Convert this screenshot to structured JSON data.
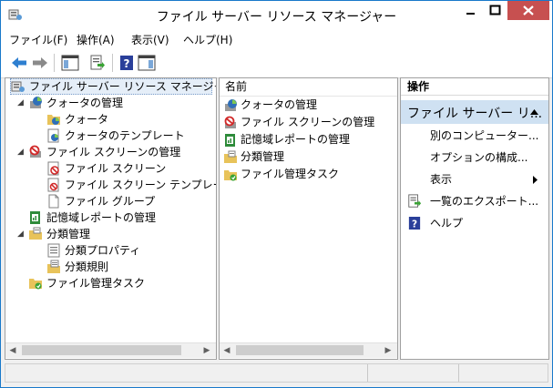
{
  "window": {
    "title": "ファイル サーバー リソース マネージャー",
    "accent_color": "#1979ca",
    "close_color": "#c75050"
  },
  "menu": {
    "items": [
      {
        "label": "ファイル(F)"
      },
      {
        "label": "操作(A)"
      },
      {
        "label": "表示(V)"
      },
      {
        "label": "ヘルプ(H)"
      }
    ]
  },
  "toolbar": {
    "icons": [
      "back-arrow-icon",
      "forward-arrow-icon",
      "show-hide-console-tree-icon",
      "export-list-icon",
      "help-icon",
      "show-hide-action-pane-icon"
    ]
  },
  "tree": {
    "root": "ファイル サーバー リソース マネージャー (ロ-",
    "items": [
      {
        "label": "クォータの管理"
      },
      {
        "label": "クォータ"
      },
      {
        "label": "クォータのテンプレート"
      },
      {
        "label": "ファイル スクリーンの管理"
      },
      {
        "label": "ファイル スクリーン"
      },
      {
        "label": "ファイル スクリーン テンプレート"
      },
      {
        "label": "ファイル グループ"
      },
      {
        "label": "記憶域レポートの管理"
      },
      {
        "label": "分類管理"
      },
      {
        "label": "分類プロパティ"
      },
      {
        "label": "分類規則"
      },
      {
        "label": "ファイル管理タスク"
      }
    ]
  },
  "list": {
    "column_header": "名前",
    "items": [
      {
        "label": "クォータの管理"
      },
      {
        "label": "ファイル スクリーンの管理"
      },
      {
        "label": "記憶域レポートの管理"
      },
      {
        "label": "分類管理"
      },
      {
        "label": "ファイル管理タスク"
      }
    ]
  },
  "actions": {
    "title": "操作",
    "group": "ファイル サーバー リ...",
    "group_highlight_color": "#cfe1f2",
    "items": [
      {
        "label": "別のコンピューター..."
      },
      {
        "label": "オプションの構成..."
      },
      {
        "label": "表示"
      },
      {
        "label": "一覧のエクスポート..."
      },
      {
        "label": "ヘルプ"
      }
    ]
  }
}
